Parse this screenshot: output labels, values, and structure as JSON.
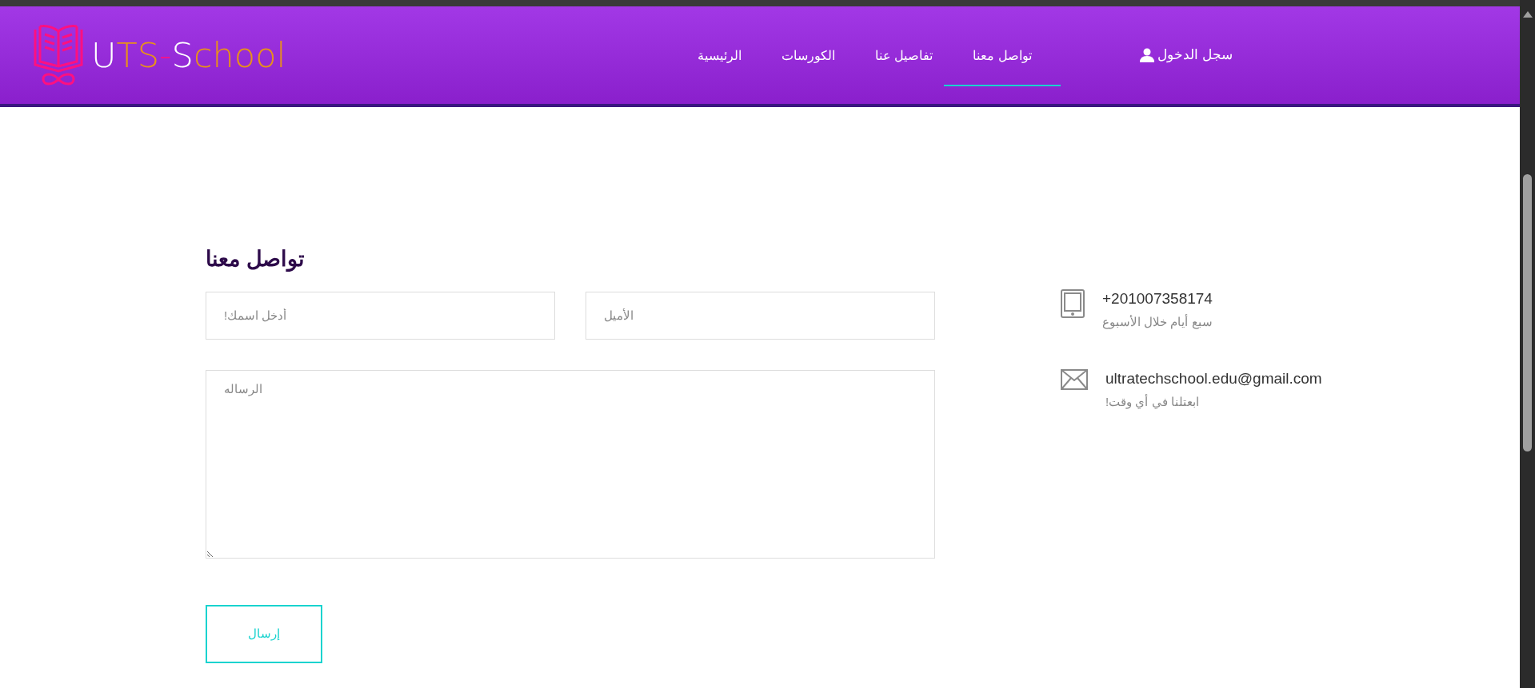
{
  "header": {
    "logo": {
      "text": "UTS-School"
    },
    "nav": [
      {
        "label": "تواصل معنا",
        "selected": true
      },
      {
        "label": "تفاصيل عنا",
        "selected": false
      },
      {
        "label": "الكورسات",
        "selected": false
      },
      {
        "label": "الرئيسية",
        "selected": false
      }
    ],
    "login": {
      "label": "سجل الدخول"
    }
  },
  "contact_form": {
    "title": "تواصل معنا",
    "name_field": {
      "placeholder": "أدخل اسمك!"
    },
    "email_field": {
      "placeholder": "الأميل"
    },
    "message_field": {
      "placeholder": "الرساله"
    },
    "submit": {
      "label": "إرسال"
    }
  },
  "contact_info": [
    {
      "kind": "phone",
      "value": "+201007358174",
      "note": "سبع أيام خلال الأسبوع"
    },
    {
      "kind": "email",
      "value": "ultratechschool.edu@gmail.com",
      "note": "ابعتلنا في أي وقت!"
    }
  ]
}
